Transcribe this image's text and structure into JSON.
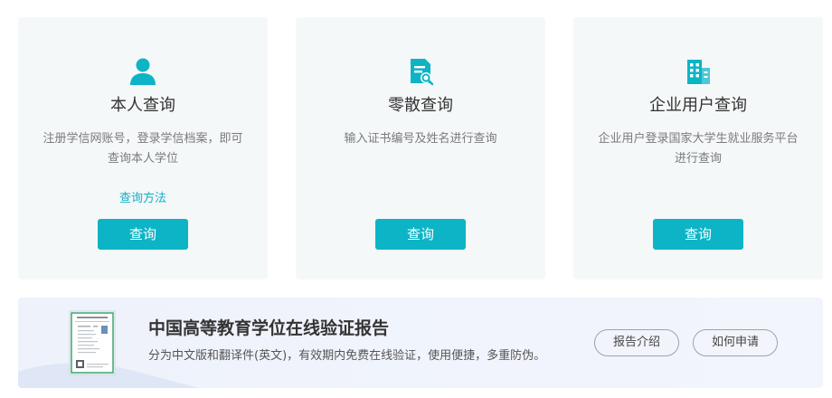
{
  "colors": {
    "accent": "#0cb4c6",
    "link": "#0fb1c4",
    "card_bg": "#f5f8f9",
    "banner_bg": "#eef2fb"
  },
  "cards": [
    {
      "icon": "person-icon",
      "title": "本人查询",
      "desc": "注册学信网账号，登录学信档案，即可查询本人学位",
      "method_link": "查询方法",
      "button": "查询"
    },
    {
      "icon": "document-search-icon",
      "title": "零散查询",
      "desc": "输入证书编号及姓名进行查询",
      "button": "查询"
    },
    {
      "icon": "building-icon",
      "title": "企业用户查询",
      "desc": "企业用户登录国家大学生就业服务平台进行查询",
      "button": "查询"
    }
  ],
  "banner": {
    "icon": "certificate-icon",
    "title": "中国高等教育学位在线验证报告",
    "desc": "分为中文版和翻译件(英文)，有效期内免费在线验证，使用便捷，多重防伪。",
    "intro_button": "报告介绍",
    "apply_button": "如何申请"
  }
}
